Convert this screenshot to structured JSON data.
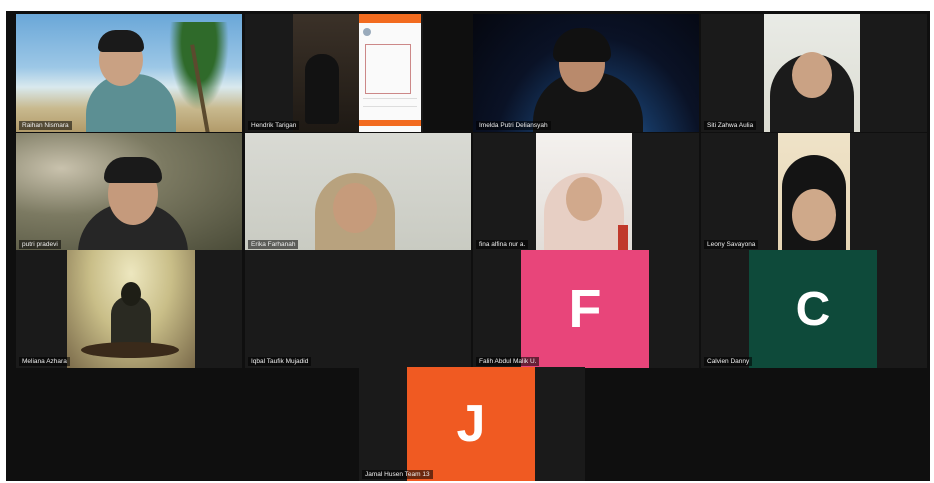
{
  "participants": [
    {
      "name": "Raihan Nismara"
    },
    {
      "name": "Hendrik Tarigan"
    },
    {
      "name": "Imelda Putri Deliansyah"
    },
    {
      "name": "Siti Zahwa Aulia"
    },
    {
      "name": "putri pradevi"
    },
    {
      "name": "Erika Farhanah"
    },
    {
      "name": "fina alfina nur a."
    },
    {
      "name": "Leony Savayona"
    },
    {
      "name": "Meliana Azhara"
    },
    {
      "name": "Iqbal Taufik Mujadid"
    },
    {
      "name": "Falih Abdul Malik U.",
      "initial": "F",
      "color": "#e8457a"
    },
    {
      "name": "Calvien Danny",
      "initial": "C",
      "color": "#0e4a3a"
    },
    {
      "name": "Jamal Husen Team 13",
      "initial": "J",
      "color": "#f05a22"
    }
  ],
  "colors": {
    "background": "#0f0f0f",
    "tile": "#1a1a1a"
  }
}
